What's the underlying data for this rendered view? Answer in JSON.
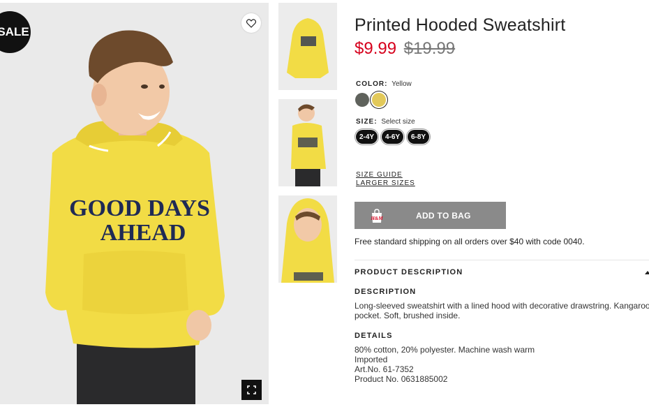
{
  "badge": {
    "sale": "SALE"
  },
  "product": {
    "title": "Printed Hooded Sweatshirt",
    "price_sale": "$9.99",
    "price_original": "$19.99"
  },
  "color": {
    "label": "COLOR:",
    "value": "Yellow",
    "swatches": [
      "#5f625c",
      "#e2c95a"
    ]
  },
  "size": {
    "label": "SIZE:",
    "value": "Select size",
    "options": [
      "2-4Y",
      "4-6Y",
      "6-8Y"
    ]
  },
  "links": {
    "size_guide": "SIZE GUIDE",
    "larger_sizes": "LARGER SIZES"
  },
  "cart": {
    "add_label": "ADD TO BAG",
    "bag_brand": "H&M",
    "button_color": "#8a8a8a"
  },
  "shipping": "Free standard shipping on all orders over $40 with code 0040.",
  "product_description": {
    "title": "PRODUCT DESCRIPTION",
    "description_title": "DESCRIPTION",
    "description_lines": [
      "Long-sleeved sweatshirt with a lined hood with decorative drawstring. Kangaroo",
      "pocket. Soft, brushed inside."
    ],
    "details_title": "DETAILS",
    "details_lines": [
      "80% cotton, 20% polyester. Machine wash warm",
      "Imported",
      "Art.No. 61-7352",
      "Product No. 0631885002"
    ]
  },
  "print_text": {
    "line1": "GOOD DAYS",
    "line2": "AHEAD"
  },
  "colors": {
    "sale_price": "#d6001c",
    "sweatshirt": "#f2dc45",
    "print": "#1f2a55"
  }
}
